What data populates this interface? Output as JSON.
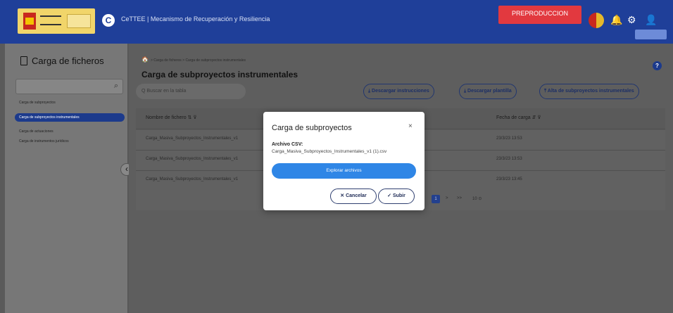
{
  "header": {
    "app_title": "CeTTEE  |  Mecanismo de Recuperación y Resiliencia",
    "env_badge": "PREPRODUCCION",
    "logo_letter": "C",
    "icons": [
      "bell-icon",
      "gear-icon",
      "user-icon"
    ]
  },
  "sidebar": {
    "title": "Carga de ficheros",
    "search_icon": "⌕",
    "items": [
      {
        "label": "Carga de subproyectos",
        "active": false
      },
      {
        "label": "Carga de subproyectos instrumentales",
        "active": true
      },
      {
        "label": "Carga de actuaciones",
        "active": false
      },
      {
        "label": "Carga de instrumentos jurídicos",
        "active": false
      }
    ],
    "collapse_icon": "‹"
  },
  "main": {
    "breadcrumb": "> Carga de ficheros > Carga de subproyectos instrumentales",
    "title": "Carga de subproyectos instrumentales",
    "help_icon": "?",
    "search_placeholder": "Q  Buscar en la tabla",
    "buttons": {
      "download_instructions": "⤓ Descargar instrucciones",
      "download_template": "⤓ Descargar plantilla",
      "add": "⤒ Alta de subproyectos instrumentales"
    },
    "table": {
      "col_file": "Nombre de fichero  ⇅ ⊽",
      "col_date": "Fecha de carga  ⇵ ⊽",
      "rows": [
        {
          "file": "Carga_Masiva_Subproyectos_Instrumentales_v1",
          "date": "23/3/23 13:53"
        },
        {
          "file": "Carga_Masiva_Subproyectos_Instrumentales_v1",
          "date": "23/3/23 13:53"
        },
        {
          "file": "Carga_Masiva_Subproyectos_Instrumentales_v1",
          "date": "23/3/23 13:45"
        }
      ]
    },
    "pager": {
      "current": "1",
      "next": ">",
      "last": ">>",
      "size": "10 ⊙"
    }
  },
  "dialog": {
    "title": "Carga de subproyectos",
    "close": "×",
    "file_label": "Archivo CSV:",
    "file_name": "Carga_Masiva_Subproyectos_Instrumentales_v1 (1).csv",
    "browse_label": "Explorar archivos",
    "cancel_label": "✕ Cancelar",
    "upload_label": "✓ Subir"
  }
}
